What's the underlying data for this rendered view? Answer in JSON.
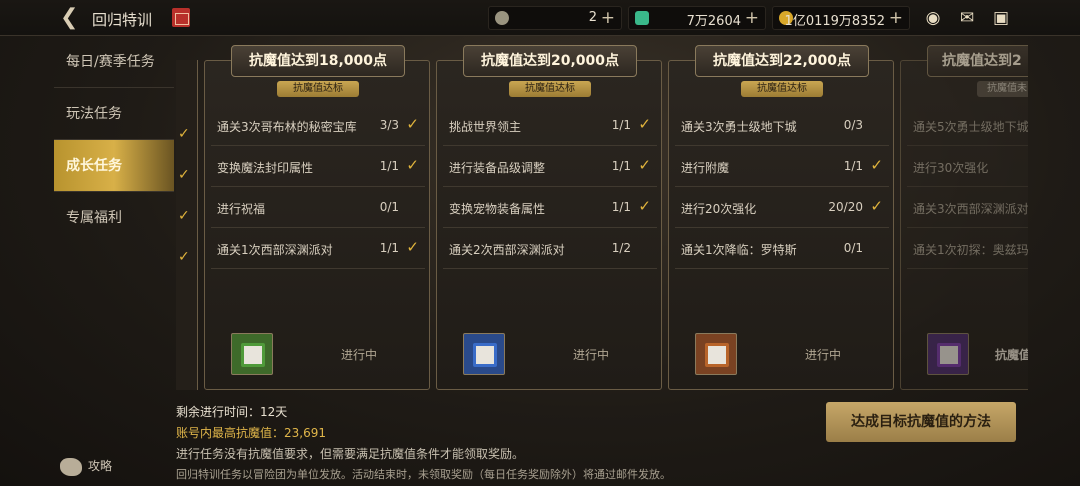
{
  "header": {
    "title": "回归特训",
    "resources": [
      {
        "icon": "coin-c-icon",
        "value": "2"
      },
      {
        "icon": "crystal-icon",
        "value": "7万2604"
      },
      {
        "icon": "gold-coin-icon",
        "value": "1亿0119万8352"
      }
    ]
  },
  "sidebar": {
    "items": [
      {
        "label": "每日/赛季任务"
      },
      {
        "label": "玩法任务"
      },
      {
        "label": "成长任务"
      },
      {
        "label": "专属福利"
      }
    ],
    "active": "成长任务",
    "guide_label": "攻略"
  },
  "cards": [
    {
      "title": "抗魔值达到18,000点",
      "badge": "抗魔值达标",
      "tasks": [
        {
          "name": "通关3次哥布林的秘密宝库",
          "progress": "3/3",
          "done": true
        },
        {
          "name": "变换魔法封印属性",
          "progress": "1/1",
          "done": true
        },
        {
          "name": "进行祝福",
          "progress": "0/1",
          "done": false
        },
        {
          "name": "通关1次西部深渊派对",
          "progress": "1/1",
          "done": true
        }
      ],
      "status": "进行中",
      "chest_color": "#4f9a3a"
    },
    {
      "title": "抗魔值达到20,000点",
      "badge": "抗魔值达标",
      "tasks": [
        {
          "name": "挑战世界领主",
          "progress": "1/1",
          "done": true
        },
        {
          "name": "进行装备品级调整",
          "progress": "1/1",
          "done": true
        },
        {
          "name": "变换宠物装备属性",
          "progress": "1/1",
          "done": true
        },
        {
          "name": "通关2次西部深渊派对",
          "progress": "1/2",
          "done": false
        }
      ],
      "status": "进行中",
      "chest_color": "#3a6cc8"
    },
    {
      "title": "抗魔值达到22,000点",
      "badge": "抗魔值达标",
      "tasks": [
        {
          "name": "通关3次勇士级地下城",
          "progress": "0/3",
          "done": false
        },
        {
          "name": "进行附魔",
          "progress": "1/1",
          "done": true
        },
        {
          "name": "进行20次强化",
          "progress": "20/20",
          "done": true
        },
        {
          "name": "通关1次降临：罗特斯",
          "progress": "0/1",
          "done": false
        }
      ],
      "status": "进行中",
      "chest_color": "#b8642a"
    },
    {
      "title": "抗魔值达到2",
      "badge": "抗魔值未",
      "tasks": [
        {
          "name": "通关5次勇士级地下城",
          "progress": "",
          "done": false
        },
        {
          "name": "进行30次强化",
          "progress": "",
          "done": false
        },
        {
          "name": "通关3次西部深渊派对",
          "progress": "",
          "done": false
        },
        {
          "name": "通关1次初探：奥兹玛",
          "progress": "",
          "done": false
        }
      ],
      "status": "抗魔值",
      "chest_color": "#7a3aa8"
    }
  ],
  "footer": {
    "remaining": "剩余进行时间：12天",
    "highest": "账号内最高抗魔值：23,691",
    "note1": "进行任务没有抗魔值要求，但需要满足抗魔值条件才能领取奖励。",
    "note2": "回归特训任务以冒险团为单位发放。活动结束时，未领取奖励（每日任务奖励除外）将通过邮件发放。",
    "method_button": "达成目标抗魔值的方法"
  },
  "colors": {
    "accent": "#e1b43c",
    "button": "#c6a768"
  }
}
